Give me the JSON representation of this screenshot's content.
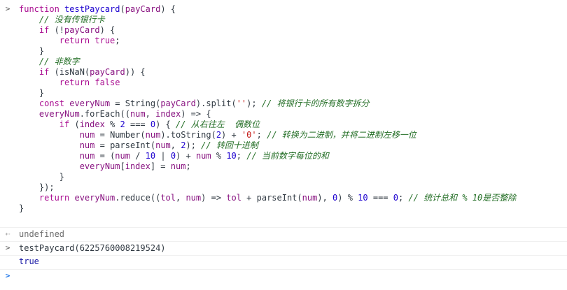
{
  "code_lines": [
    [
      {
        "t": "kw",
        "v": "function "
      },
      {
        "t": "fn",
        "v": "testPaycard"
      },
      {
        "t": "plain",
        "v": "("
      },
      {
        "t": "var",
        "v": "payCard"
      },
      {
        "t": "plain",
        "v": ") {"
      }
    ],
    [
      {
        "t": "plain",
        "v": "    "
      },
      {
        "t": "cm",
        "v": "// 没有传银行卡"
      }
    ],
    [
      {
        "t": "plain",
        "v": "    "
      },
      {
        "t": "kw",
        "v": "if"
      },
      {
        "t": "plain",
        "v": " (!"
      },
      {
        "t": "var",
        "v": "payCard"
      },
      {
        "t": "plain",
        "v": ") {"
      }
    ],
    [
      {
        "t": "plain",
        "v": "        "
      },
      {
        "t": "kw",
        "v": "return "
      },
      {
        "t": "kw",
        "v": "true"
      },
      {
        "t": "plain",
        "v": ";"
      }
    ],
    [
      {
        "t": "plain",
        "v": "    }"
      }
    ],
    [
      {
        "t": "plain",
        "v": "    "
      },
      {
        "t": "cm",
        "v": "// 非数字"
      }
    ],
    [
      {
        "t": "plain",
        "v": "    "
      },
      {
        "t": "kw",
        "v": "if"
      },
      {
        "t": "plain",
        "v": " ("
      },
      {
        "t": "plain",
        "v": "isNaN"
      },
      {
        "t": "plain",
        "v": "("
      },
      {
        "t": "var",
        "v": "payCard"
      },
      {
        "t": "plain",
        "v": ")) {"
      }
    ],
    [
      {
        "t": "plain",
        "v": "        "
      },
      {
        "t": "kw",
        "v": "return "
      },
      {
        "t": "kw",
        "v": "false"
      }
    ],
    [
      {
        "t": "plain",
        "v": "    }"
      }
    ],
    [
      {
        "t": "plain",
        "v": "    "
      },
      {
        "t": "kw",
        "v": "const "
      },
      {
        "t": "var",
        "v": "everyNum"
      },
      {
        "t": "plain",
        "v": " = String("
      },
      {
        "t": "var",
        "v": "payCard"
      },
      {
        "t": "plain",
        "v": ").split("
      },
      {
        "t": "str",
        "v": "''"
      },
      {
        "t": "plain",
        "v": "); "
      },
      {
        "t": "cm",
        "v": "// 将银行卡的所有数字拆分"
      }
    ],
    [
      {
        "t": "plain",
        "v": "    "
      },
      {
        "t": "var",
        "v": "everyNum"
      },
      {
        "t": "plain",
        "v": ".forEach(("
      },
      {
        "t": "var",
        "v": "num"
      },
      {
        "t": "plain",
        "v": ", "
      },
      {
        "t": "var",
        "v": "index"
      },
      {
        "t": "plain",
        "v": ") => {"
      }
    ],
    [
      {
        "t": "plain",
        "v": "        "
      },
      {
        "t": "kw",
        "v": "if"
      },
      {
        "t": "plain",
        "v": " ("
      },
      {
        "t": "var",
        "v": "index"
      },
      {
        "t": "plain",
        "v": " % "
      },
      {
        "t": "num",
        "v": "2"
      },
      {
        "t": "plain",
        "v": " === "
      },
      {
        "t": "num",
        "v": "0"
      },
      {
        "t": "plain",
        "v": ") { "
      },
      {
        "t": "cm",
        "v": "// 从右往左  偶数位"
      }
    ],
    [
      {
        "t": "plain",
        "v": "            "
      },
      {
        "t": "var",
        "v": "num"
      },
      {
        "t": "plain",
        "v": " = Number("
      },
      {
        "t": "var",
        "v": "num"
      },
      {
        "t": "plain",
        "v": ").toString("
      },
      {
        "t": "num",
        "v": "2"
      },
      {
        "t": "plain",
        "v": ") + "
      },
      {
        "t": "str",
        "v": "'0'"
      },
      {
        "t": "plain",
        "v": "; "
      },
      {
        "t": "cm",
        "v": "// 转换为二进制，并将二进制左移一位"
      }
    ],
    [
      {
        "t": "plain",
        "v": "            "
      },
      {
        "t": "var",
        "v": "num"
      },
      {
        "t": "plain",
        "v": " = parseInt("
      },
      {
        "t": "var",
        "v": "num"
      },
      {
        "t": "plain",
        "v": ", "
      },
      {
        "t": "num",
        "v": "2"
      },
      {
        "t": "plain",
        "v": "); "
      },
      {
        "t": "cm",
        "v": "// 转回十进制"
      }
    ],
    [
      {
        "t": "plain",
        "v": "            "
      },
      {
        "t": "var",
        "v": "num"
      },
      {
        "t": "plain",
        "v": " = ("
      },
      {
        "t": "var",
        "v": "num"
      },
      {
        "t": "plain",
        "v": " / "
      },
      {
        "t": "num",
        "v": "10"
      },
      {
        "t": "plain",
        "v": " | "
      },
      {
        "t": "num",
        "v": "0"
      },
      {
        "t": "plain",
        "v": ") + "
      },
      {
        "t": "var",
        "v": "num"
      },
      {
        "t": "plain",
        "v": " % "
      },
      {
        "t": "num",
        "v": "10"
      },
      {
        "t": "plain",
        "v": "; "
      },
      {
        "t": "cm",
        "v": "// 当前数字每位的和"
      }
    ],
    [
      {
        "t": "plain",
        "v": "            "
      },
      {
        "t": "var",
        "v": "everyNum"
      },
      {
        "t": "plain",
        "v": "["
      },
      {
        "t": "var",
        "v": "index"
      },
      {
        "t": "plain",
        "v": "] = "
      },
      {
        "t": "var",
        "v": "num"
      },
      {
        "t": "plain",
        "v": ";"
      }
    ],
    [
      {
        "t": "plain",
        "v": "        }"
      }
    ],
    [
      {
        "t": "plain",
        "v": "    });"
      }
    ],
    [
      {
        "t": "plain",
        "v": "    "
      },
      {
        "t": "kw",
        "v": "return "
      },
      {
        "t": "var",
        "v": "everyNum"
      },
      {
        "t": "plain",
        "v": ".reduce(("
      },
      {
        "t": "var",
        "v": "tol"
      },
      {
        "t": "plain",
        "v": ", "
      },
      {
        "t": "var",
        "v": "num"
      },
      {
        "t": "plain",
        "v": ") => "
      },
      {
        "t": "var",
        "v": "tol"
      },
      {
        "t": "plain",
        "v": " + parseInt("
      },
      {
        "t": "var",
        "v": "num"
      },
      {
        "t": "plain",
        "v": "), "
      },
      {
        "t": "num",
        "v": "0"
      },
      {
        "t": "plain",
        "v": ") % "
      },
      {
        "t": "num",
        "v": "10"
      },
      {
        "t": "plain",
        "v": " === "
      },
      {
        "t": "num",
        "v": "0"
      },
      {
        "t": "plain",
        "v": "; "
      },
      {
        "t": "cm",
        "v": "// 统计总和 % 10是否整除"
      }
    ],
    [
      {
        "t": "plain",
        "v": "}"
      }
    ]
  ],
  "result1": "undefined",
  "input2": "testPaycard(6225760008219524)",
  "result2": "true",
  "icons": {
    "input_chevron": ">",
    "output_arrow": "⇠",
    "prompt_chevron": ">"
  }
}
